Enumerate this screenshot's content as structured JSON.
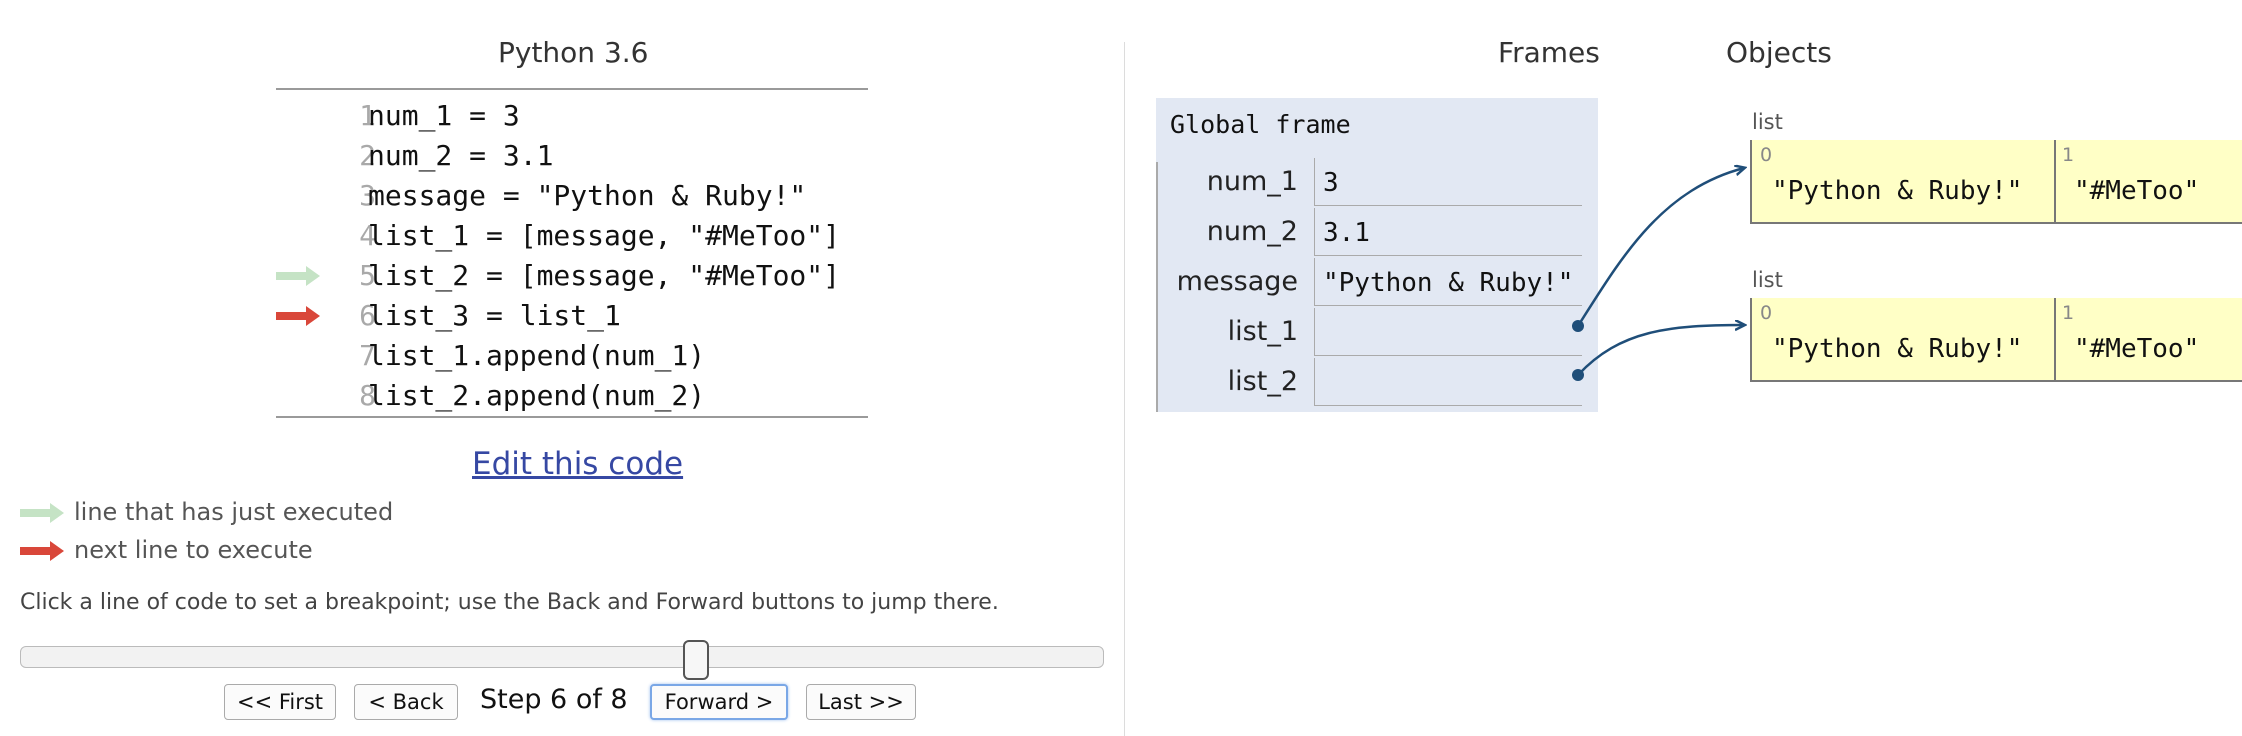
{
  "header": {
    "language": "Python 3.6"
  },
  "code": {
    "lines": [
      {
        "num": "1",
        "text": "num_1 = 3"
      },
      {
        "num": "2",
        "text": "num_2 = 3.1"
      },
      {
        "num": "3",
        "text": "message = \"Python & Ruby!\""
      },
      {
        "num": "4",
        "text": "list_1 = [message, \"#MeToo\"]"
      },
      {
        "num": "5",
        "text": "list_2 = [message, \"#MeToo\"]"
      },
      {
        "num": "6",
        "text": "list_3 = list_1"
      },
      {
        "num": "7",
        "text": "list_1.append(num_1)"
      },
      {
        "num": "8",
        "text": "list_2.append(num_2)"
      }
    ],
    "just_executed_line": 5,
    "next_line": 6
  },
  "edit_link": "Edit this code",
  "legend": {
    "just_executed": "line that has just executed",
    "next": "next line to execute"
  },
  "hint": "Click a line of code to set a breakpoint; use the Back and Forward buttons to jump there.",
  "nav": {
    "first": "<< First",
    "back": "< Back",
    "step_text": "Step 6 of 8",
    "forward": "Forward >",
    "last": "Last >>",
    "current_step": 6,
    "total_steps": 8
  },
  "viz": {
    "frames_header": "Frames",
    "objects_header": "Objects",
    "global_frame": {
      "title": "Global frame",
      "vars": [
        {
          "name": "num_1",
          "value": "3"
        },
        {
          "name": "num_2",
          "value": "3.1"
        },
        {
          "name": "message",
          "value": "\"Python & Ruby!\""
        },
        {
          "name": "list_1",
          "value": ""
        },
        {
          "name": "list_2",
          "value": ""
        }
      ]
    },
    "objects": [
      {
        "type": "list",
        "items": [
          {
            "index": "0",
            "value": "\"Python & Ruby!\""
          },
          {
            "index": "1",
            "value": "\"#MeToo\""
          }
        ]
      },
      {
        "type": "list",
        "items": [
          {
            "index": "0",
            "value": "\"Python & Ruby!\""
          },
          {
            "index": "1",
            "value": "\"#MeToo\""
          }
        ]
      }
    ]
  },
  "colors": {
    "just_executed_arrow": "#c5e3c5",
    "next_arrow": "#d9473a",
    "frame_bg": "#e2e8f3",
    "object_bg": "#ffffc6",
    "pointer": "#1f4e79",
    "link": "#3648a3"
  }
}
